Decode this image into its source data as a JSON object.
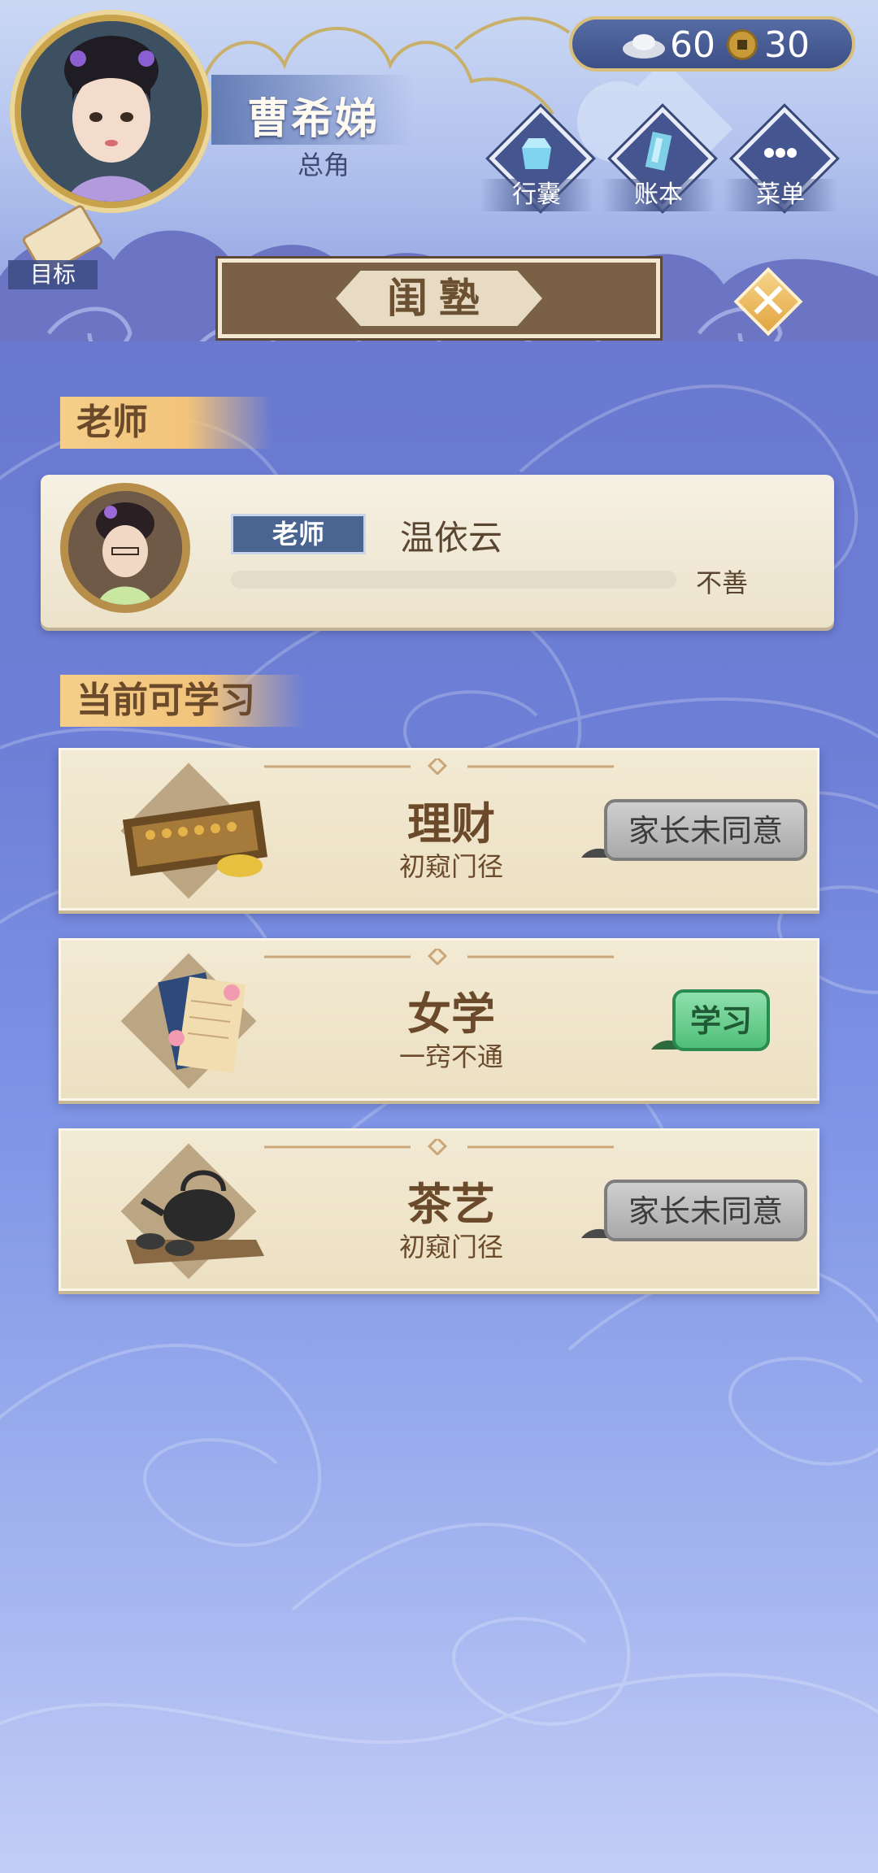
{
  "player": {
    "name": "曹希娣",
    "role": "总角"
  },
  "currency": {
    "silver": "60",
    "copper": "30",
    "silver_icon": "silver-ingot-icon",
    "copper_icon": "copper-coin-icon"
  },
  "nav": {
    "items": [
      {
        "label": "行囊",
        "icon": "bundle-icon"
      },
      {
        "label": "账本",
        "icon": "ledger-icon"
      },
      {
        "label": "菜单",
        "icon": "menu-dots-icon"
      }
    ],
    "goal_label": "目标"
  },
  "title": "闺塾",
  "teacher_section": {
    "header": "老师",
    "tag": "老师",
    "name": "温依云",
    "relation": "不善"
  },
  "courses_section": {
    "header": "当前可学习",
    "courses": [
      {
        "name": "理财",
        "level": "初窥门径",
        "button": "家长未同意",
        "icon": "abacus-icon",
        "enabled": false
      },
      {
        "name": "女学",
        "level": "一窍不通",
        "button": "学习",
        "icon": "book-scroll-icon",
        "enabled": true
      },
      {
        "name": "茶艺",
        "level": "初窥门径",
        "button": "家长未同意",
        "icon": "teapot-icon",
        "enabled": false
      }
    ]
  },
  "colors": {
    "accent_gold": "#e2a440",
    "text_brown": "#6a4a2a",
    "button_green": "#4fbf78",
    "button_gray": "#a9a9a9"
  }
}
